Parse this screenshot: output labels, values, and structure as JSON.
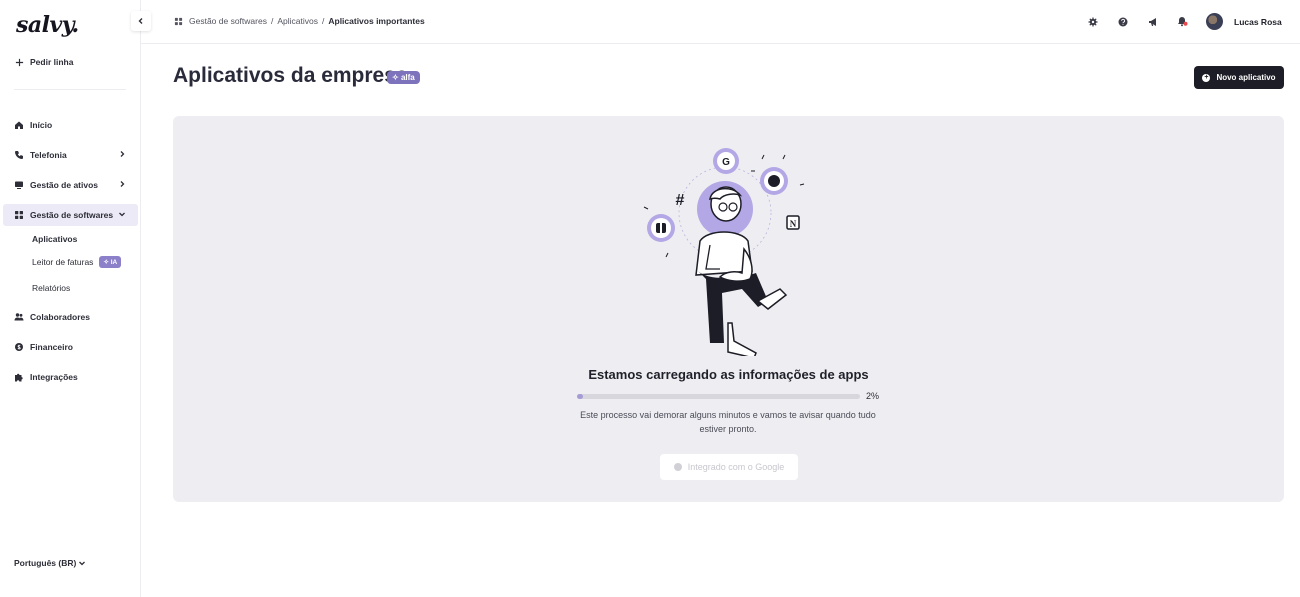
{
  "sidebar": {
    "logo": "salvy.",
    "pedir_linha": "Pedir linha",
    "items": [
      {
        "label": "Início",
        "icon": "home-icon"
      },
      {
        "label": "Telefonia",
        "icon": "phone-icon"
      },
      {
        "label": "Gestão de ativos",
        "icon": "monitor-icon"
      },
      {
        "label": "Gestão de softwares",
        "icon": "apps-icon"
      },
      {
        "label": "Colaboradores",
        "icon": "users-icon"
      },
      {
        "label": "Financeiro",
        "icon": "coin-icon"
      },
      {
        "label": "Integrações",
        "icon": "puzzle-icon"
      }
    ],
    "subitems": [
      {
        "label": "Aplicativos"
      },
      {
        "label": "Leitor de faturas",
        "badge": "IA"
      },
      {
        "label": "Relatórios"
      }
    ],
    "language": "Português (BR)"
  },
  "header": {
    "breadcrumb": [
      "Gestão de softwares",
      "Aplicativos",
      "Aplicativos importantes"
    ],
    "user_name": "Lucas Rosa"
  },
  "main": {
    "title": "Aplicativos da empresa",
    "title_badge": "alfa",
    "new_app_button": "Novo aplicativo",
    "loading_title": "Estamos carregando as informações de apps",
    "progress_percent": 2,
    "progress_label": "2%",
    "description": "Este processo vai demorar alguns minutos e vamos te avisar quando tudo estiver pronto.",
    "google_button": "Integrado com o Google"
  },
  "colors": {
    "accent": "#7d73bd",
    "active_nav_bg": "#eceaf6",
    "primary_button": "#1c1d26",
    "panel_bg": "#eeeef2"
  }
}
